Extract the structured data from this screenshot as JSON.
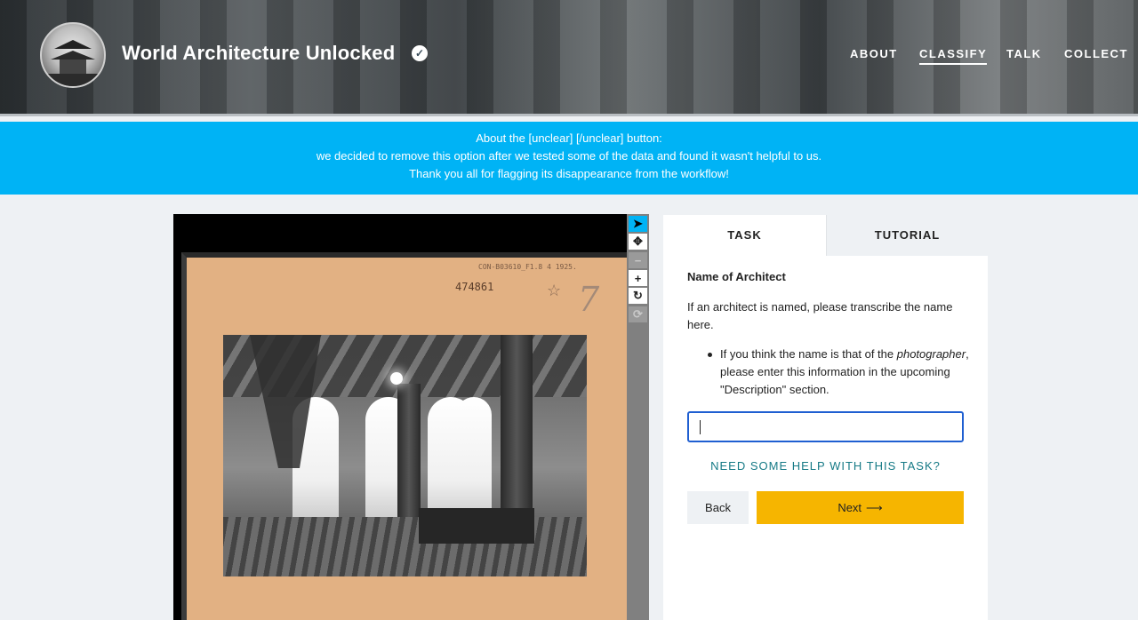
{
  "header": {
    "title": "World Architecture Unlocked",
    "nav": [
      {
        "label": "ABOUT",
        "active": false
      },
      {
        "label": "CLASSIFY",
        "active": true
      },
      {
        "label": "TALK",
        "active": false
      },
      {
        "label": "COLLECT",
        "active": false
      }
    ],
    "verified_icon": "check-circle-icon"
  },
  "banner": {
    "lines": [
      "About the [unclear] [/unclear] button:",
      "we decided to remove this option after we tested some of the data and found it wasn't helpful to us.",
      "Thank you all for flagging its disappearance from the workflow!"
    ],
    "color": "#00b3f5"
  },
  "subject": {
    "reference": "CON-B03610_F1.8 4 1925.",
    "number": "474861",
    "handwritten": "7"
  },
  "toolbar": {
    "tools": [
      {
        "icon": "pointer-icon",
        "active": true
      },
      {
        "icon": "move-icon",
        "active": false
      },
      {
        "icon": "zoom-out-icon",
        "disabled": true
      },
      {
        "icon": "zoom-in-icon",
        "active": false
      },
      {
        "icon": "rotate-icon",
        "active": false
      },
      {
        "icon": "reset-icon",
        "disabled": true
      }
    ]
  },
  "panel": {
    "tabs": [
      {
        "label": "TASK",
        "active": true
      },
      {
        "label": "TUTORIAL",
        "active": false
      }
    ],
    "question_title": "Name of Architect",
    "question_text": "If an architect is named, please transcribe the name here.",
    "bullet_before": "If you think the name is that of the ",
    "bullet_emphasis": "photographer",
    "bullet_after": ", please enter this information in the upcoming \"Description\" section.",
    "answer_value": "",
    "help_label": "NEED SOME HELP WITH THIS TASK?",
    "back_label": "Back",
    "next_label": "Next",
    "accent_color": "#f6b500"
  }
}
